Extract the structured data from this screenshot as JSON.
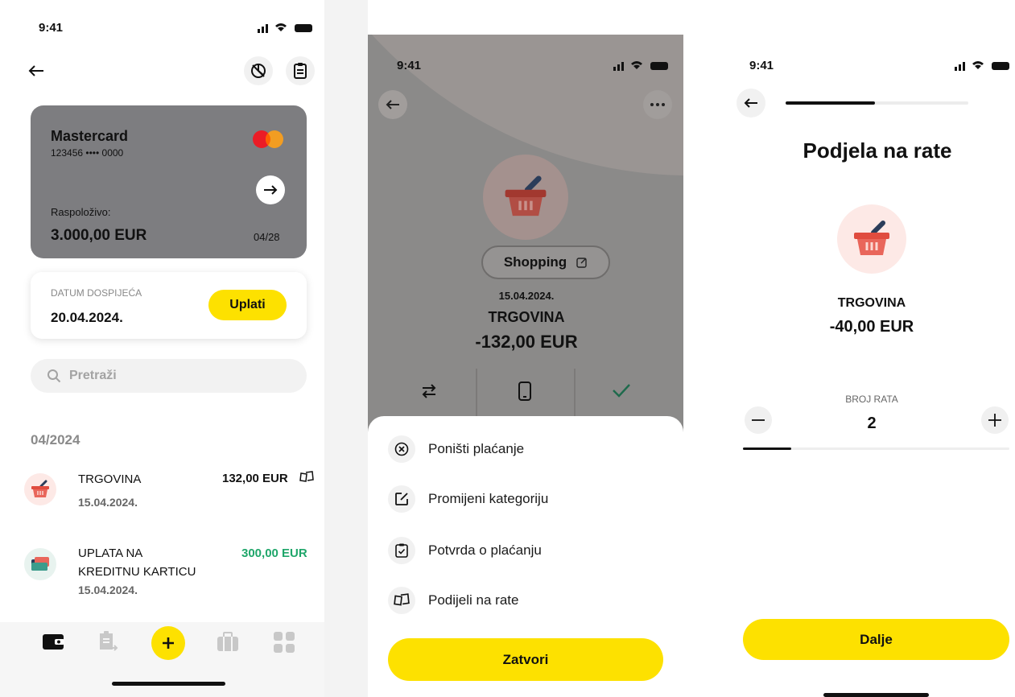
{
  "screen1": {
    "status_time": "9:41",
    "card": {
      "brand": "Mastercard",
      "number": "123456 •••• 0000",
      "available_label": "Raspoloživo:",
      "available_amount": "3.000,00 EUR",
      "expiry": "04/28"
    },
    "due": {
      "label": "DATUM DOSPIJEĆA",
      "date": "20.04.2024.",
      "pay_button": "Uplati"
    },
    "search": {
      "placeholder": "Pretraži"
    },
    "month_header": "04/2024",
    "transactions": [
      {
        "title": "TRGOVINA",
        "date": "15.04.2024.",
        "amount": "132,00 EUR"
      },
      {
        "title_line1": "UPLATA NA",
        "title_line2": "KREDITNU KARTICU",
        "date": "15.04.2024.",
        "amount": "300,00 EUR"
      }
    ],
    "tab_icons": [
      "wallet-icon",
      "document-transfer-icon",
      "plus-icon",
      "briefcase-icon",
      "grid-icon"
    ]
  },
  "screen2": {
    "status_time": "9:41",
    "category_label": "Shopping",
    "date": "15.04.2024.",
    "merchant": "TRGOVINA",
    "amount": "-132,00 EUR",
    "menu": [
      {
        "label": "Poništi plaćanje",
        "icon": "cancel-circle-icon"
      },
      {
        "label": "Promijeni kategoriju",
        "icon": "edit-icon"
      },
      {
        "label": "Potvrda o plaćanju",
        "icon": "receipt-check-icon"
      },
      {
        "label": "Podijeli na rate",
        "icon": "split-cards-icon"
      }
    ],
    "close_button": "Zatvori"
  },
  "screen3": {
    "status_time": "9:41",
    "progress": 0.49,
    "title": "Podjela na rate",
    "merchant": "TRGOVINA",
    "amount": "-40,00 EUR",
    "installments_label": "BROJ RATA",
    "installments_value": "2",
    "installments_slider": 0.18,
    "next_button": "Dalje"
  },
  "colors": {
    "accent_yellow": "#fde100",
    "positive_green": "#1fa66a",
    "card_gray": "#7d7d80",
    "basket_red": "#e9665b"
  }
}
